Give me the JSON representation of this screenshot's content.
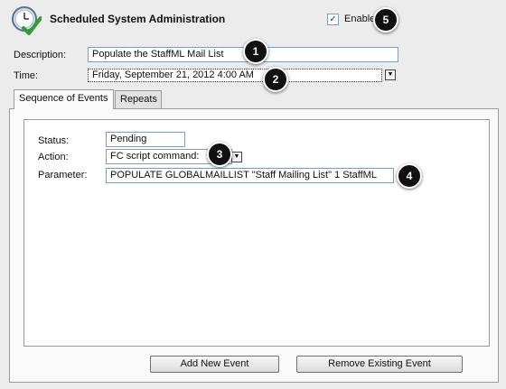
{
  "window": {
    "title": "Scheduled System Administration"
  },
  "enabled": {
    "label": "Enabled",
    "checked": true,
    "check_glyph": "✓"
  },
  "description": {
    "label": "Description:",
    "value": "Populate the StaffML Mail List"
  },
  "time": {
    "label": "Time:",
    "value": "Friday, September 21, 2012 4:00 AM"
  },
  "tabs": [
    {
      "label": "Sequence of Events",
      "active": true
    },
    {
      "label": "Repeats",
      "active": false
    }
  ],
  "event": {
    "status_label": "Status:",
    "status_value": "Pending",
    "action_label": "Action:",
    "action_value": "FC script command:",
    "parameter_label": "Parameter:",
    "parameter_value": "POPULATE GLOBALMAILLIST \"Staff Mailing List\" 1 StaffML"
  },
  "buttons": {
    "add": "Add New Event",
    "remove": "Remove Existing Event"
  },
  "dropdown_glyph": "▼",
  "callouts": [
    "1",
    "2",
    "3",
    "4",
    "5"
  ],
  "icons": {
    "app": "clock-check-icon",
    "dropdown": "chevron-down-icon"
  },
  "colors": {
    "callout_bg": "#111111",
    "check_green": "#2ea02e"
  }
}
